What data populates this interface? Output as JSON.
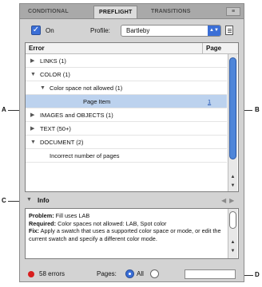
{
  "tabs": [
    {
      "label": "CONDITIONAL"
    },
    {
      "label": "PREFLIGHT"
    },
    {
      "label": "TRANSITIONS"
    }
  ],
  "tab_menu_glyph": "≡",
  "toolbar": {
    "on_checked": true,
    "on_label": "On",
    "profile_label": "Profile:",
    "profile_value": "Bartleby"
  },
  "list": {
    "col_error": "Error",
    "col_page": "Page",
    "rows": [
      {
        "text": "LINKS (1)",
        "expanded": false,
        "indent": 0,
        "page": ""
      },
      {
        "text": "COLOR (1)",
        "expanded": true,
        "indent": 0,
        "page": ""
      },
      {
        "text": "Color space not allowed (1)",
        "expanded": true,
        "indent": 1,
        "page": ""
      },
      {
        "text": "Page Item",
        "expanded": null,
        "indent": 2,
        "page": "1",
        "selected": true
      },
      {
        "text": "IMAGES and OBJECTS (1)",
        "expanded": false,
        "indent": 0,
        "page": ""
      },
      {
        "text": "TEXT (50+)",
        "expanded": false,
        "indent": 0,
        "page": ""
      },
      {
        "text": "DOCUMENT (2)",
        "expanded": true,
        "indent": 0,
        "page": ""
      },
      {
        "text": "Incorrect number of pages",
        "expanded": null,
        "indent": 1,
        "page": ""
      }
    ]
  },
  "info": {
    "label": "Info",
    "problem_label": "Problem:",
    "problem_text": " Fill uses LAB",
    "required_label": "Required:",
    "required_text": " Color spaces not allowed: LAB, Spot color",
    "fix_label": "Fix:",
    "fix_text": " Apply a swatch that uses a supported color space or mode, or edit the current swatch and specify a different color mode."
  },
  "footer": {
    "errors": "58 errors",
    "pages_label": "Pages:",
    "all_label": "All",
    "pages_value": ""
  },
  "callouts": {
    "a": "A",
    "b": "B",
    "c": "C",
    "d": "D"
  },
  "colors": {
    "accent": "#3a6ed6",
    "error_dot": "#d81e1e",
    "selection": "#bcd2ee"
  }
}
